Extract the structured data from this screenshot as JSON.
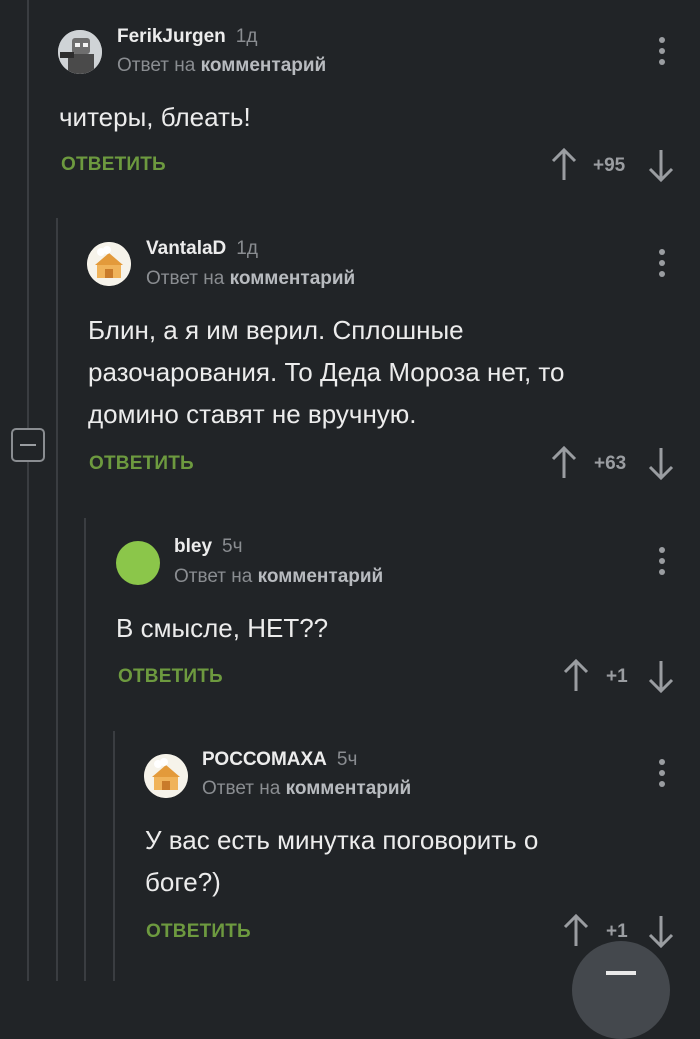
{
  "comments": [
    {
      "author": "FerikJurgen",
      "time": "1д",
      "reply_prefix": "Ответ на",
      "reply_target": "комментарий",
      "text": "читеры, блеать!",
      "reply_label": "ОТВЕТИТЬ",
      "rating": "+95",
      "avatar_icon": "robot-avatar-icon"
    },
    {
      "author": "VantalaD",
      "time": "1д",
      "reply_prefix": "Ответ на",
      "reply_target": "комментарий",
      "text": "Блин, а я им верил. Сплошные разочарования. То Деда Мороза нет, то домино ставят не вручную.",
      "reply_label": "ОТВЕТИТЬ",
      "rating": "+63",
      "avatar_icon": "default-avatar-icon"
    },
    {
      "author": "bley",
      "time": "5ч",
      "reply_prefix": "Ответ на",
      "reply_target": "комментарий",
      "text": "В смысле, НЕТ??",
      "reply_label": "ОТВЕТИТЬ",
      "rating": "+1",
      "avatar_icon": "green-circle-avatar-icon"
    },
    {
      "author": "РОССОМАХА",
      "time": "5ч",
      "reply_prefix": "Ответ на",
      "reply_target": "комментарий",
      "text": "У вас есть минутка поговорить о боге?)",
      "reply_label": "ОТВЕТИТЬ",
      "rating": "+1",
      "avatar_icon": "default-avatar-icon"
    }
  ],
  "colors": {
    "background": "#212427",
    "reply_green": "#6d9a3f",
    "muted": "#8a8d91",
    "avatar_green": "#8bc64a"
  }
}
